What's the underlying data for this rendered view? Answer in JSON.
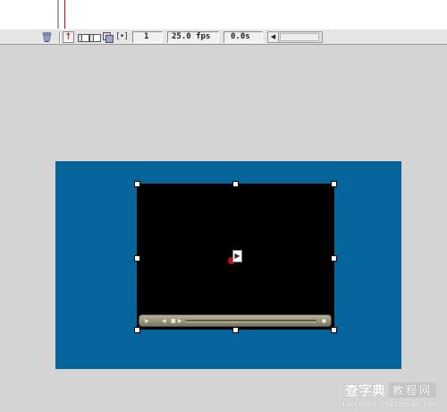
{
  "statusbar": {
    "frame": "1",
    "fps": "25.0 fps",
    "time": "0.0s",
    "icons": [
      "trash-icon",
      "center-frame-icon",
      "onion-skin-icon",
      "onion-skin-outlines-icon",
      "edit-multiple-frames-icon",
      "modify-onion-markers-icon",
      "scroll-left-arrow-icon"
    ]
  },
  "stage": {
    "background_color": "#036599",
    "component_icon": "flv-playback-component-icon"
  },
  "colors": {
    "workspace": "#d4d4d4",
    "playhead": "#e00000",
    "registration_point": "#c8101a"
  },
  "watermark": {
    "brand": "查字典",
    "sub": "教程网",
    "url": "jiaocheng.chazidian.com"
  }
}
